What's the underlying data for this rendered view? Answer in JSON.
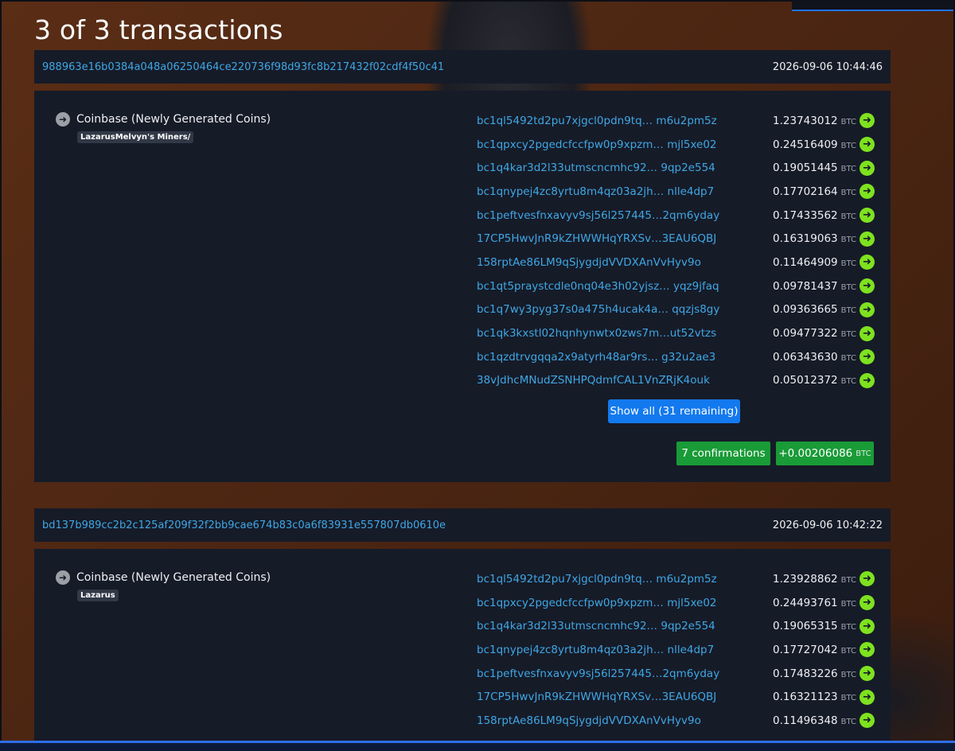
{
  "page_title": "3 of 3 transactions",
  "colors": {
    "link": "#3fa7e4",
    "panel": "#161b28",
    "confirm_green": "#199b37",
    "arrow_green": "#7ee21f",
    "primary_button": "#1379ee"
  },
  "icons": {
    "input_arrow": "arrow-right-circle-grey",
    "output_arrow": "arrow-right-circle-green"
  },
  "transactions": [
    {
      "txid": "988963e16b0384a048a06250464ce220736f98d93fc8b217432f02cdf4f50c41",
      "timestamp": "2026-09-06 10:44:46",
      "input_label": "Coinbase (Newly Generated Coins)",
      "input_tag": "LazarusMelvyn's Miners/",
      "outputs": [
        {
          "address": "bc1ql5492td2pu7xjgcl0pdn9tq… m6u2pm5z",
          "amount": "1.23743012",
          "unit": "BTC"
        },
        {
          "address": "bc1qpxcy2pgedcfccfpw0p9xpzm… mjl5xe02",
          "amount": "0.24516409",
          "unit": "BTC"
        },
        {
          "address": "bc1q4kar3d2l33utmscncmhc92… 9qp2e554",
          "amount": "0.19051445",
          "unit": "BTC"
        },
        {
          "address": "bc1qnypej4zc8yrtu8m4qz03a2jh… nlle4dp7",
          "amount": "0.17702164",
          "unit": "BTC"
        },
        {
          "address": "bc1peftvesfnxavyv9sj56l257445…2qm6yday",
          "amount": "0.17433562",
          "unit": "BTC"
        },
        {
          "address": "17CP5HwvJnR9kZHWWHqYRXSv…3EAU6QBJ",
          "amount": "0.16319063",
          "unit": "BTC"
        },
        {
          "address": "158rptAe86LM9qSjygdjdVVDXAnVvHyv9o",
          "amount": "0.11464909",
          "unit": "BTC"
        },
        {
          "address": "bc1qt5praystcdle0nq04e3h02yjsz… yqz9jfaq",
          "amount": "0.09781437",
          "unit": "BTC"
        },
        {
          "address": "bc1q7wy3pyg37s0a475h4ucak4a… qqzjs8gy",
          "amount": "0.09363665",
          "unit": "BTC"
        },
        {
          "address": "bc1qk3kxstl02hqnhynwtx0zws7m…ut52vtzs",
          "amount": "0.09477322",
          "unit": "BTC"
        },
        {
          "address": "bc1qzdtrvgqqa2x9atyrh48ar9rs… g32u2ae3",
          "amount": "0.06343630",
          "unit": "BTC"
        },
        {
          "address": "38vJdhcMNudZSNHPQdmfCAL1VnZRjK4ouk",
          "amount": "0.05012372",
          "unit": "BTC"
        }
      ],
      "show_all_label": "Show all (31 remaining)",
      "confirmations_label": "7 confirmations",
      "net_amount": "+0.00206086",
      "net_unit": "BTC"
    },
    {
      "txid": "bd137b989cc2b2c125af209f32f2bb9cae674b83c0a6f83931e557807db0610e",
      "timestamp": "2026-09-06 10:42:22",
      "input_label": "Coinbase (Newly Generated Coins)",
      "input_tag": "Lazarus",
      "outputs": [
        {
          "address": "bc1ql5492td2pu7xjgcl0pdn9tq… m6u2pm5z",
          "amount": "1.23928862",
          "unit": "BTC"
        },
        {
          "address": "bc1qpxcy2pgedcfccfpw0p9xpzm… mjl5xe02",
          "amount": "0.24493761",
          "unit": "BTC"
        },
        {
          "address": "bc1q4kar3d2l33utmscncmhc92… 9qp2e554",
          "amount": "0.19065315",
          "unit": "BTC"
        },
        {
          "address": "bc1qnypej4zc8yrtu8m4qz03a2jh… nlle4dp7",
          "amount": "0.17727042",
          "unit": "BTC"
        },
        {
          "address": "bc1peftvesfnxavyv9sj56l257445…2qm6yday",
          "amount": "0.17483226",
          "unit": "BTC"
        },
        {
          "address": "17CP5HwvJnR9kZHWWHqYRXSv…3EAU6QBJ",
          "amount": "0.16321123",
          "unit": "BTC"
        },
        {
          "address": "158rptAe86LM9qSjygdjdVVDXAnVvHyv9o",
          "amount": "0.11496348",
          "unit": "BTC"
        }
      ]
    }
  ]
}
